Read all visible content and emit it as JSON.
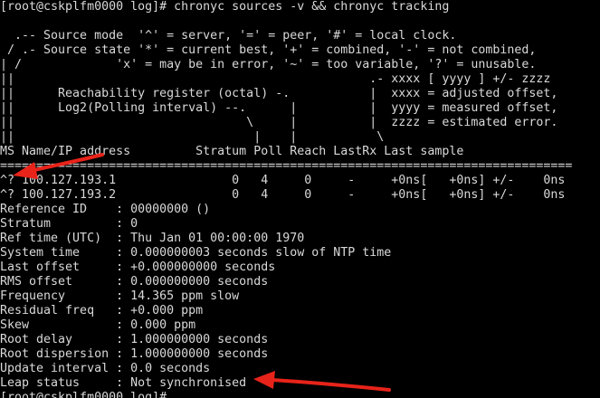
{
  "terminal": {
    "text_color": "#d9d9d9",
    "background_color": "#000000",
    "annotation_arrow_color": "#e8231a",
    "lines": [
      "[root@cskplfm0000 log]# chronyc sources -v && chronyc tracking",
      "",
      "  .-- Source mode  '^' = server, '=' = peer, '#' = local clock.",
      " / .- Source state '*' = current best, '+' = combined, '-' = not combined,",
      "| /             'x' = may be in error, '~' = too variable, '?' = unusable.",
      "||                                                 .- xxxx [ yyyy ] +/- zzzz",
      "||      Reachability register (octal) -.           |  xxxx = adjusted offset,",
      "||      Log2(Polling interval) --.      |          |  yyyy = measured offset,",
      "||                                \\     |          |  zzzz = estimated error.",
      "||                                 |    |           \\",
      "MS Name/IP address         Stratum Poll Reach LastRx Last sample",
      "===============================================================================",
      "^? 100.127.193.1                0   4     0     -     +0ns[   +0ns] +/-    0ns",
      "^? 100.127.193.2                0   4     0     -     +0ns[   +0ns] +/-    0ns",
      "Reference ID    : 00000000 ()",
      "Stratum         : 0",
      "Ref time (UTC)  : Thu Jan 01 00:00:00 1970",
      "System time     : 0.000000003 seconds slow of NTP time",
      "Last offset     : +0.000000000 seconds",
      "RMS offset      : 0.000000000 seconds",
      "Frequency       : 14.365 ppm slow",
      "Residual freq   : +0.000 ppm",
      "Skew            : 0.000 ppm",
      "Root delay      : 1.000000000 seconds",
      "Root dispersion : 1.000000000 seconds",
      "Update interval : 0.0 seconds",
      "Leap status     : Not synchronised",
      "[root@cskplfm0000 log]#"
    ]
  }
}
